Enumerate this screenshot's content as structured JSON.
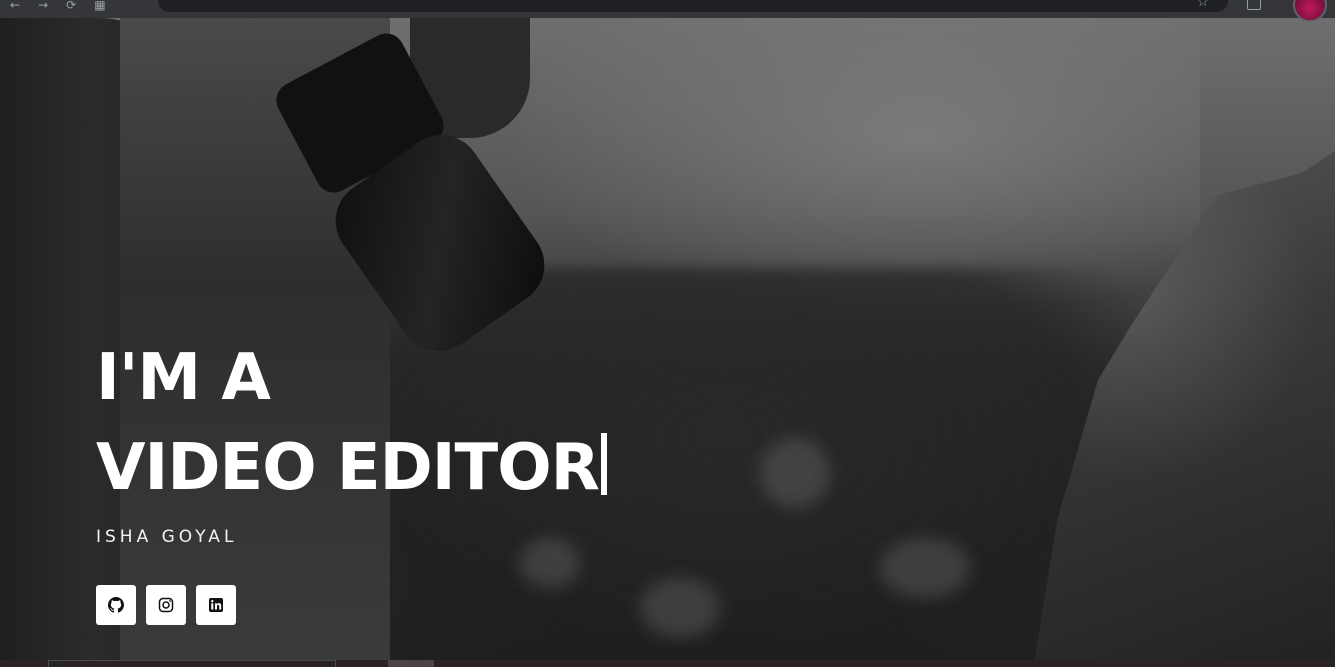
{
  "hero": {
    "headline_line1": "I'M A",
    "headline_line2": "VIDEO EDITOR",
    "subtitle": "ISHA GOYAL"
  },
  "socials": [
    {
      "name": "github",
      "icon": "github-icon"
    },
    {
      "name": "instagram",
      "icon": "instagram-icon"
    },
    {
      "name": "linkedin",
      "icon": "linkedin-icon"
    }
  ],
  "colors": {
    "text": "#ffffff",
    "social_button_bg": "#ffffff",
    "social_icon": "#111111"
  }
}
